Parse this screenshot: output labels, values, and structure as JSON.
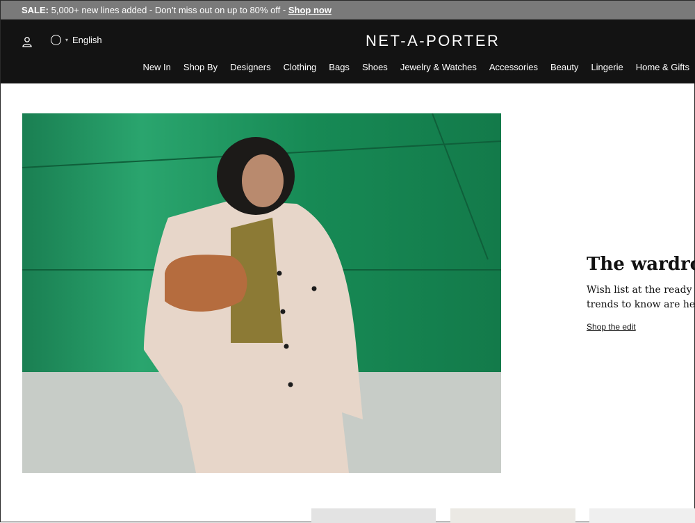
{
  "promo": {
    "lead": "SALE:",
    "text": "5,000+ new lines added - Don’t miss out on up to 80% off -",
    "link": "Shop now"
  },
  "header": {
    "language": "English",
    "logo": "NET-A-PORTER",
    "nav": [
      "New In",
      "Shop By",
      "Designers",
      "Clothing",
      "Bags",
      "Shoes",
      "Jewelry & Watches",
      "Accessories",
      "Beauty",
      "Lingerie",
      "Home & Gifts"
    ]
  },
  "hero": {
    "title": "The wardrobe",
    "description_line1": "Wish list at the ready – the",
    "description_line2": "trends to know are here",
    "cta": "Shop the edit"
  },
  "icons": {
    "account": "user-icon",
    "language": "globe-icon"
  }
}
